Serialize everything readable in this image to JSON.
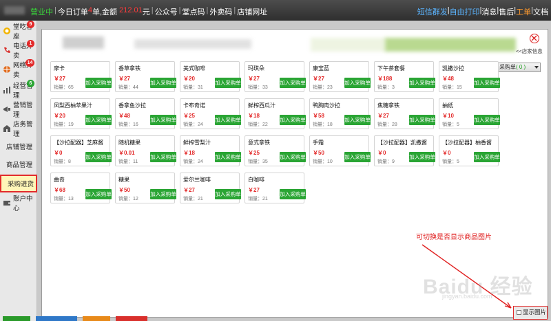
{
  "topbar": {
    "status": "营业中",
    "today_orders_label": "今日订单",
    "today_orders": "4",
    "orders_unit": "单,",
    "amount_label": "金额",
    "amount": "212.01",
    "amount_unit": "元",
    "nav": [
      "公众号",
      "堂点码",
      "外卖码",
      "店铺网址"
    ],
    "right_links": [
      "短信群发",
      "自由打印",
      "消息",
      "售后",
      "工单",
      "文档"
    ]
  },
  "sidebar": {
    "items": [
      {
        "label": "堂吃客座",
        "badge": "9",
        "badge_color": "#e32b2b"
      },
      {
        "label": "电话外卖",
        "badge": "1",
        "badge_color": "#e32b2b"
      },
      {
        "label": "网络外卖",
        "badge": "14",
        "badge_color": "#e32b2b"
      },
      {
        "label": "经营管理",
        "badge": "6",
        "badge_color": "#2aa534"
      },
      {
        "label": "营销管理",
        "badge": "",
        "badge_color": ""
      },
      {
        "label": "店务管理",
        "badge": "",
        "badge_color": ""
      }
    ],
    "subitems": [
      "店铺管理",
      "商品管理",
      "采购进货"
    ],
    "account": "账户中心"
  },
  "panel": {
    "store_info_link": "<<店家信息",
    "cart_label": "采购单",
    "cart_count": "( 0 )",
    "add_label": "加入采购单",
    "sales_prefix": "销量：",
    "currency": "￥",
    "products": [
      {
        "name": "摩卡",
        "price": "27",
        "sales": "65"
      },
      {
        "name": "香草拿铁",
        "price": "27",
        "sales": "44"
      },
      {
        "name": "美式咖啡",
        "price": "20",
        "sales": "31"
      },
      {
        "name": "玛琪朵",
        "price": "27",
        "sales": "33"
      },
      {
        "name": "康宝蓝",
        "price": "27",
        "sales": "23"
      },
      {
        "name": "下午茶套餐",
        "price": "188",
        "sales": "3"
      },
      {
        "name": "凯撒沙拉",
        "price": "48",
        "sales": "15"
      },
      {
        "name": "凤梨西柚苹果汁",
        "price": "20",
        "sales": "19"
      },
      {
        "name": "香拿鱼沙拉",
        "price": "48",
        "sales": "16"
      },
      {
        "name": "卡布奇诺",
        "price": "25",
        "sales": "24"
      },
      {
        "name": "鲜榨西瓜汁",
        "price": "18",
        "sales": "22"
      },
      {
        "name": "鸭胸肉沙拉",
        "price": "58",
        "sales": "18"
      },
      {
        "name": "焦糖拿铁",
        "price": "27",
        "sales": "28"
      },
      {
        "name": "抽纸",
        "price": "10",
        "sales": "5"
      },
      {
        "name": "【沙拉配器】芝麻酱",
        "price": "0",
        "sales": "8"
      },
      {
        "name": "随机糖果",
        "price": "0.01",
        "sales": "11"
      },
      {
        "name": "鲜榨雪梨汁",
        "price": "18",
        "sales": "24"
      },
      {
        "name": "意式拿铁",
        "price": "25",
        "sales": "35"
      },
      {
        "name": "手霜",
        "price": "50",
        "sales": "10"
      },
      {
        "name": "【沙拉配器】凯撒酱",
        "price": "0",
        "sales": "9"
      },
      {
        "name": "【沙拉配器】柚香酱",
        "price": "0",
        "sales": "5"
      },
      {
        "name": "曲奇",
        "price": "68",
        "sales": "13"
      },
      {
        "name": "糖果",
        "price": "50",
        "sales": "12"
      },
      {
        "name": "爱尔兰咖啡",
        "price": "27",
        "sales": "21"
      },
      {
        "name": "白咖啡",
        "price": "27",
        "sales": "21"
      }
    ]
  },
  "annotation": {
    "hint": "可切换是否显示商品图片",
    "show_images": "显示图片"
  },
  "watermark": {
    "brand": "Baidu 经验",
    "url": "jingyan.baidu.com"
  }
}
